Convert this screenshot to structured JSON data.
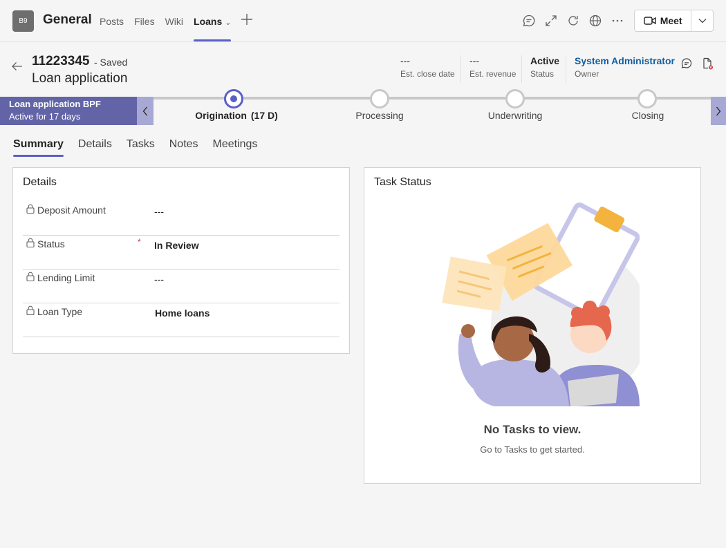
{
  "team": {
    "avatar": "B9",
    "channel": "General"
  },
  "top_tabs": [
    {
      "label": "Posts",
      "active": false
    },
    {
      "label": "Files",
      "active": false
    },
    {
      "label": "Wiki",
      "active": false
    },
    {
      "label": "Loans",
      "active": true
    }
  ],
  "toolbar_icons": [
    "chat-icon",
    "expand-icon",
    "refresh-icon",
    "globe-icon",
    "more-icon"
  ],
  "meet": {
    "label": "Meet"
  },
  "record": {
    "id": "11223345",
    "saved": "- Saved",
    "entity": "Loan application",
    "header_fields": [
      {
        "value": "---",
        "label": "Est. close date"
      },
      {
        "value": "---",
        "label": "Est. revenue"
      },
      {
        "value": "Active",
        "label": "Status"
      },
      {
        "value": "System Administrator",
        "label": "Owner"
      }
    ]
  },
  "bpf": {
    "name": "Loan application BPF",
    "status": "Active for 17 days",
    "stages": [
      {
        "label": "Origination",
        "days": "(17 D)",
        "active": true
      },
      {
        "label": "Processing",
        "active": false
      },
      {
        "label": "Underwriting",
        "active": false
      },
      {
        "label": "Closing",
        "active": false
      }
    ]
  },
  "form_tabs": [
    {
      "label": "Summary",
      "active": true
    },
    {
      "label": "Details",
      "active": false
    },
    {
      "label": "Tasks",
      "active": false
    },
    {
      "label": "Notes",
      "active": false
    },
    {
      "label": "Meetings",
      "active": false
    }
  ],
  "details": {
    "title": "Details",
    "fields": [
      {
        "label": "Deposit Amount",
        "value": "---",
        "required": false
      },
      {
        "label": "Status",
        "value": "In Review",
        "required": true,
        "required_mark": "*"
      },
      {
        "label": "Lending Limit",
        "value": "---",
        "required": false
      },
      {
        "label": "Loan Type",
        "value": "Home loans",
        "required": false
      }
    ]
  },
  "task_status": {
    "title": "Task Status",
    "empty_title": "No Tasks to view.",
    "empty_sub": "Go to Tasks to get started."
  },
  "colors": {
    "brand": "#5b5fc7",
    "bpf_active": "#6264a7",
    "link": "#115ea3",
    "required": "#c4314b"
  }
}
